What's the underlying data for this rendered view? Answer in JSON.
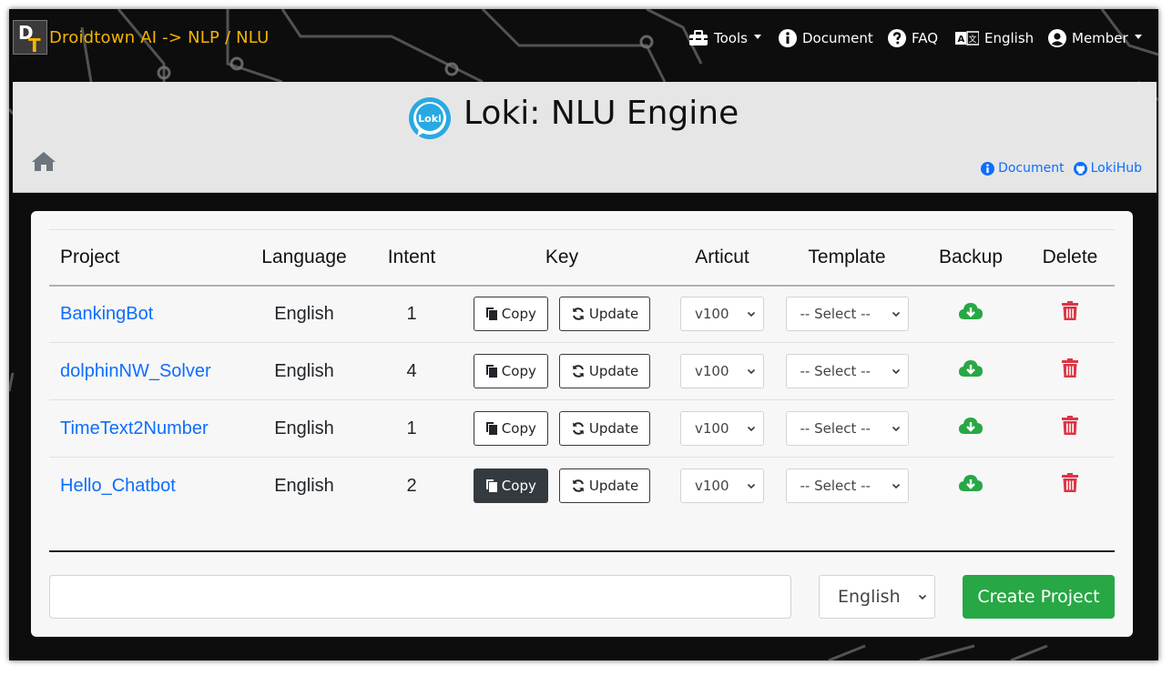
{
  "navbar": {
    "brand": "Droidtown AI -> NLP / NLU",
    "items": [
      {
        "label": "Tools",
        "icon": "toolbox-icon"
      },
      {
        "label": "Document",
        "icon": "info-circle-icon"
      },
      {
        "label": "FAQ",
        "icon": "question-circle-icon"
      },
      {
        "label": "English",
        "icon": "language-icon"
      },
      {
        "label": "Member",
        "icon": "user-circle-icon"
      }
    ]
  },
  "header": {
    "title": "Loki: NLU Engine",
    "logo_text": "Loki",
    "links": {
      "document": "Document",
      "lokihub": "LokiHub"
    }
  },
  "table": {
    "headers": [
      "Project",
      "Language",
      "Intent",
      "Key",
      "Articut",
      "Template",
      "Backup",
      "Delete"
    ],
    "copy_label": "Copy",
    "update_label": "Update",
    "articut_value": "v100",
    "template_value": "-- Select --",
    "rows": [
      {
        "project": "BankingBot",
        "language": "English",
        "intent": "1"
      },
      {
        "project": "dolphinNW_Solver",
        "language": "English",
        "intent": "4"
      },
      {
        "project": "TimeText2Number",
        "language": "English",
        "intent": "1"
      },
      {
        "project": "Hello_Chatbot",
        "language": "English",
        "intent": "2"
      }
    ]
  },
  "create": {
    "input_value": "",
    "language": "English",
    "button": "Create Project"
  },
  "colors": {
    "brand": "#f4b400",
    "link": "#0d6efd",
    "backup": "#28a745",
    "delete": "#dc3545",
    "create": "#28a745"
  }
}
